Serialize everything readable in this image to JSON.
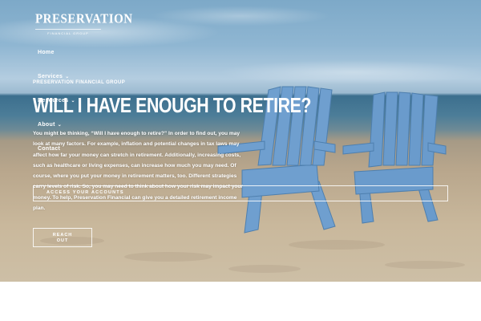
{
  "brand": {
    "name": "PRESERVATION",
    "tagline": "FINANCIAL GROUP"
  },
  "nav": {
    "items": [
      {
        "label": "Home",
        "has_dropdown": false
      },
      {
        "label": "Services",
        "has_dropdown": true
      },
      {
        "label": "Resources",
        "has_dropdown": true
      },
      {
        "label": "About",
        "has_dropdown": true
      },
      {
        "label": "Contact",
        "has_dropdown": false
      }
    ],
    "chevron": "⌄"
  },
  "hero": {
    "eyebrow": "PRESERVATION FINANCIAL GROUP",
    "headline": "WILL I HAVE ENOUGH TO RETIRE?",
    "body": "You might be thinking, “Will I have enough to retire?” In order to find out, you may look at many factors. For example, inflation and potential changes in tax laws may affect how far your money can stretch in retirement. Additionally, increasing costs, such as healthcare or living expenses, can increase how much you may need. Of course, where you put your money in retirement matters, too. Different strategies carry levels of risk. So, you may need to think about how your risk may impact your money. To help, Preservation Financial can give you a detailed retirement income plan.",
    "access_label": "ACCESS YOUR ACCOUNTS",
    "cta_line1": "REACH",
    "cta_line2": "OUT"
  },
  "colors": {
    "text": "#ffffff",
    "chair": "#6f9fcf",
    "ocean": "#3c6f8e",
    "sand": "#c9b89c"
  }
}
